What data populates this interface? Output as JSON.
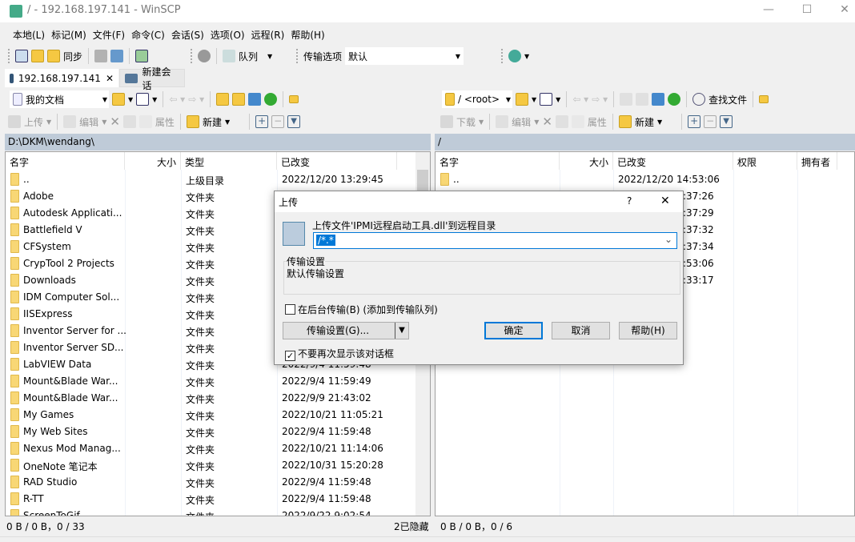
{
  "window": {
    "title": "/ - 192.168.197.141 - WinSCP",
    "min": "—",
    "max": "☐",
    "close": "✕"
  },
  "menu": [
    "本地(L)",
    "标记(M)",
    "文件(F)",
    "命令(C)",
    "会话(S)",
    "选项(O)",
    "远程(R)",
    "帮助(H)"
  ],
  "toolbar": {
    "sync": "同步",
    "queue": "队列",
    "transfer_options_label": "传输选项",
    "transfer_options_value": "默认"
  },
  "tabs": [
    {
      "label": "192.168.197.141",
      "close": "✕"
    },
    {
      "label": "新建会话"
    }
  ],
  "left": {
    "location": "我的文档",
    "upload": "上传",
    "edit": "编辑",
    "properties": "属性",
    "new": "新建",
    "path": "D:\\DKM\\wendang\\",
    "columns": [
      "名字",
      "大小",
      "类型",
      "已改变"
    ],
    "rows": [
      [
        "..",
        "",
        "上级目录",
        "2022/12/20  13:29:45"
      ],
      [
        "Adobe",
        "",
        "文件夹",
        ""
      ],
      [
        "Autodesk Applicati...",
        "",
        "文件夹",
        ""
      ],
      [
        "Battlefield V",
        "",
        "文件夹",
        ""
      ],
      [
        "CFSystem",
        "",
        "文件夹",
        ""
      ],
      [
        "CrypTool 2 Projects",
        "",
        "文件夹",
        ""
      ],
      [
        "Downloads",
        "",
        "文件夹",
        ""
      ],
      [
        "IDM Computer Sol...",
        "",
        "文件夹",
        ""
      ],
      [
        "IISExpress",
        "",
        "文件夹",
        ""
      ],
      [
        "Inventor Server for ...",
        "",
        "文件夹",
        ""
      ],
      [
        "Inventor Server SD...",
        "",
        "文件夹",
        ""
      ],
      [
        "LabVIEW Data",
        "",
        "文件夹",
        "2022/9/4  11:59:48"
      ],
      [
        "Mount&Blade War...",
        "",
        "文件夹",
        "2022/9/4  11:59:49"
      ],
      [
        "Mount&Blade War...",
        "",
        "文件夹",
        "2022/9/9  21:43:02"
      ],
      [
        "My Games",
        "",
        "文件夹",
        "2022/10/21  11:05:21"
      ],
      [
        "My Web Sites",
        "",
        "文件夹",
        "2022/9/4  11:59:48"
      ],
      [
        "Nexus Mod Manag...",
        "",
        "文件夹",
        "2022/10/21  11:14:06"
      ],
      [
        "OneNote 笔记本",
        "",
        "文件夹",
        "2022/10/31  15:20:28"
      ],
      [
        "RAD Studio",
        "",
        "文件夹",
        "2022/9/4  11:59:48"
      ],
      [
        "R-TT",
        "",
        "文件夹",
        "2022/9/4  11:59:48"
      ],
      [
        "ScreenToGif",
        "",
        "文件夹",
        "2022/9/22  9:02:54"
      ]
    ],
    "status": "0 B / 0 B，0 / 33"
  },
  "right": {
    "location": "/ <root>",
    "find": "查找文件",
    "download": "下载",
    "edit": "编辑",
    "properties": "属性",
    "new": "新建",
    "path": "/",
    "columns": [
      "名字",
      "大小",
      "已改变",
      "权限",
      "拥有者"
    ],
    "rows": [
      [
        "..",
        "",
        "2022/12/20 14:53:06"
      ],
      [
        "",
        "",
        ":37:26"
      ],
      [
        "",
        "",
        ":37:29"
      ],
      [
        "",
        "",
        ":37:32"
      ],
      [
        "",
        "",
        ":37:34"
      ],
      [
        "",
        "",
        ":53:06"
      ],
      [
        "",
        "",
        ":33:17"
      ]
    ],
    "hidden": "2已隐藏",
    "status": "0 B / 0 B，0 / 6"
  },
  "dialog": {
    "title": "上传",
    "help": "?",
    "close": "✕",
    "prompt": "上传文件'IPMI远程启动工具.dll'到远程目录",
    "target": "/*.*",
    "settings_label": "传输设置",
    "settings_value": "默认传输设置",
    "background": "在后台传输(B) (添加到传输队列)",
    "background_checked": false,
    "settings_button": "传输设置(G)...",
    "ok": "确定",
    "cancel": "取消",
    "helpbtn": "帮助(H)",
    "dont_show": "不要再次显示该对话框",
    "dont_show_checked": true
  }
}
